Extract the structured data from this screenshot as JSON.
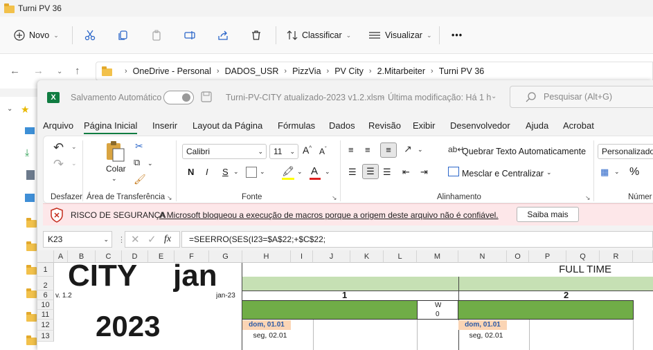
{
  "explorer": {
    "title": "Turni PV 36",
    "toolbar": {
      "new_label": "Novo",
      "sort_label": "Classificar",
      "view_label": "Visualizar",
      "more_label": "•••"
    },
    "breadcrumbs": [
      "OneDrive - Personal",
      "DADOS_USR",
      "PizzVia",
      "PV City",
      "2.Mitarbeiter",
      "Turni PV 36"
    ]
  },
  "excel": {
    "autosave_label": "Salvamento Automático",
    "doc_title": "Turni-PV-CITY atualizado-2023 v1.2.xlsm",
    "modified": "Última modificação: Há 1 h",
    "search_placeholder": "Pesquisar (Alt+G)",
    "menu": [
      "Arquivo",
      "Página Inicial",
      "Inserir",
      "Layout da Página",
      "Fórmulas",
      "Dados",
      "Revisão",
      "Exibir",
      "Desenvolvedor",
      "Ajuda",
      "Acrobat"
    ],
    "ribbon": {
      "groups": [
        "Desfazer",
        "Área de Transferência",
        "Fonte",
        "Alinhamento",
        "Númer"
      ],
      "paste_label": "Colar",
      "font_name": "Calibri",
      "font_size": "11",
      "bold": "N",
      "italic": "I",
      "underline": "S",
      "wrap_label": "Quebrar Texto Automaticamente",
      "merge_label": "Mesclar e Centralizar",
      "number_format": "Personalizado"
    },
    "security": {
      "title": "RISCO DE SEGURANÇA",
      "message": "A Microsoft bloqueou a execução de macros porque a origem deste arquivo não é confiável.",
      "button": "Saiba mais"
    },
    "formula_bar": {
      "name_box": "K23",
      "fx": "fx",
      "formula": "=SEERRO(SES(I23=$A$22;+$C$22;"
    },
    "columns": [
      "A",
      "B",
      "C",
      "D",
      "E",
      "F",
      "G",
      "H",
      "I",
      "J",
      "K",
      "L",
      "M",
      "N",
      "O",
      "P",
      "Q",
      "R"
    ],
    "rows": [
      "1",
      "2",
      "6",
      "10",
      "11",
      "12",
      "13"
    ],
    "cells": {
      "city": "CITY",
      "month": "jan",
      "version": "v. 1.2",
      "monthyear": "jan-23",
      "year": "2023",
      "full_time": "FULL TIME",
      "week1": "1",
      "week2": "2",
      "w_label": "W",
      "w_value": "0",
      "day1": "dom, 01.01",
      "day2": "seg, 02.01",
      "day1b": "dom, 01.01",
      "day2b": "seg, 02.01"
    }
  }
}
